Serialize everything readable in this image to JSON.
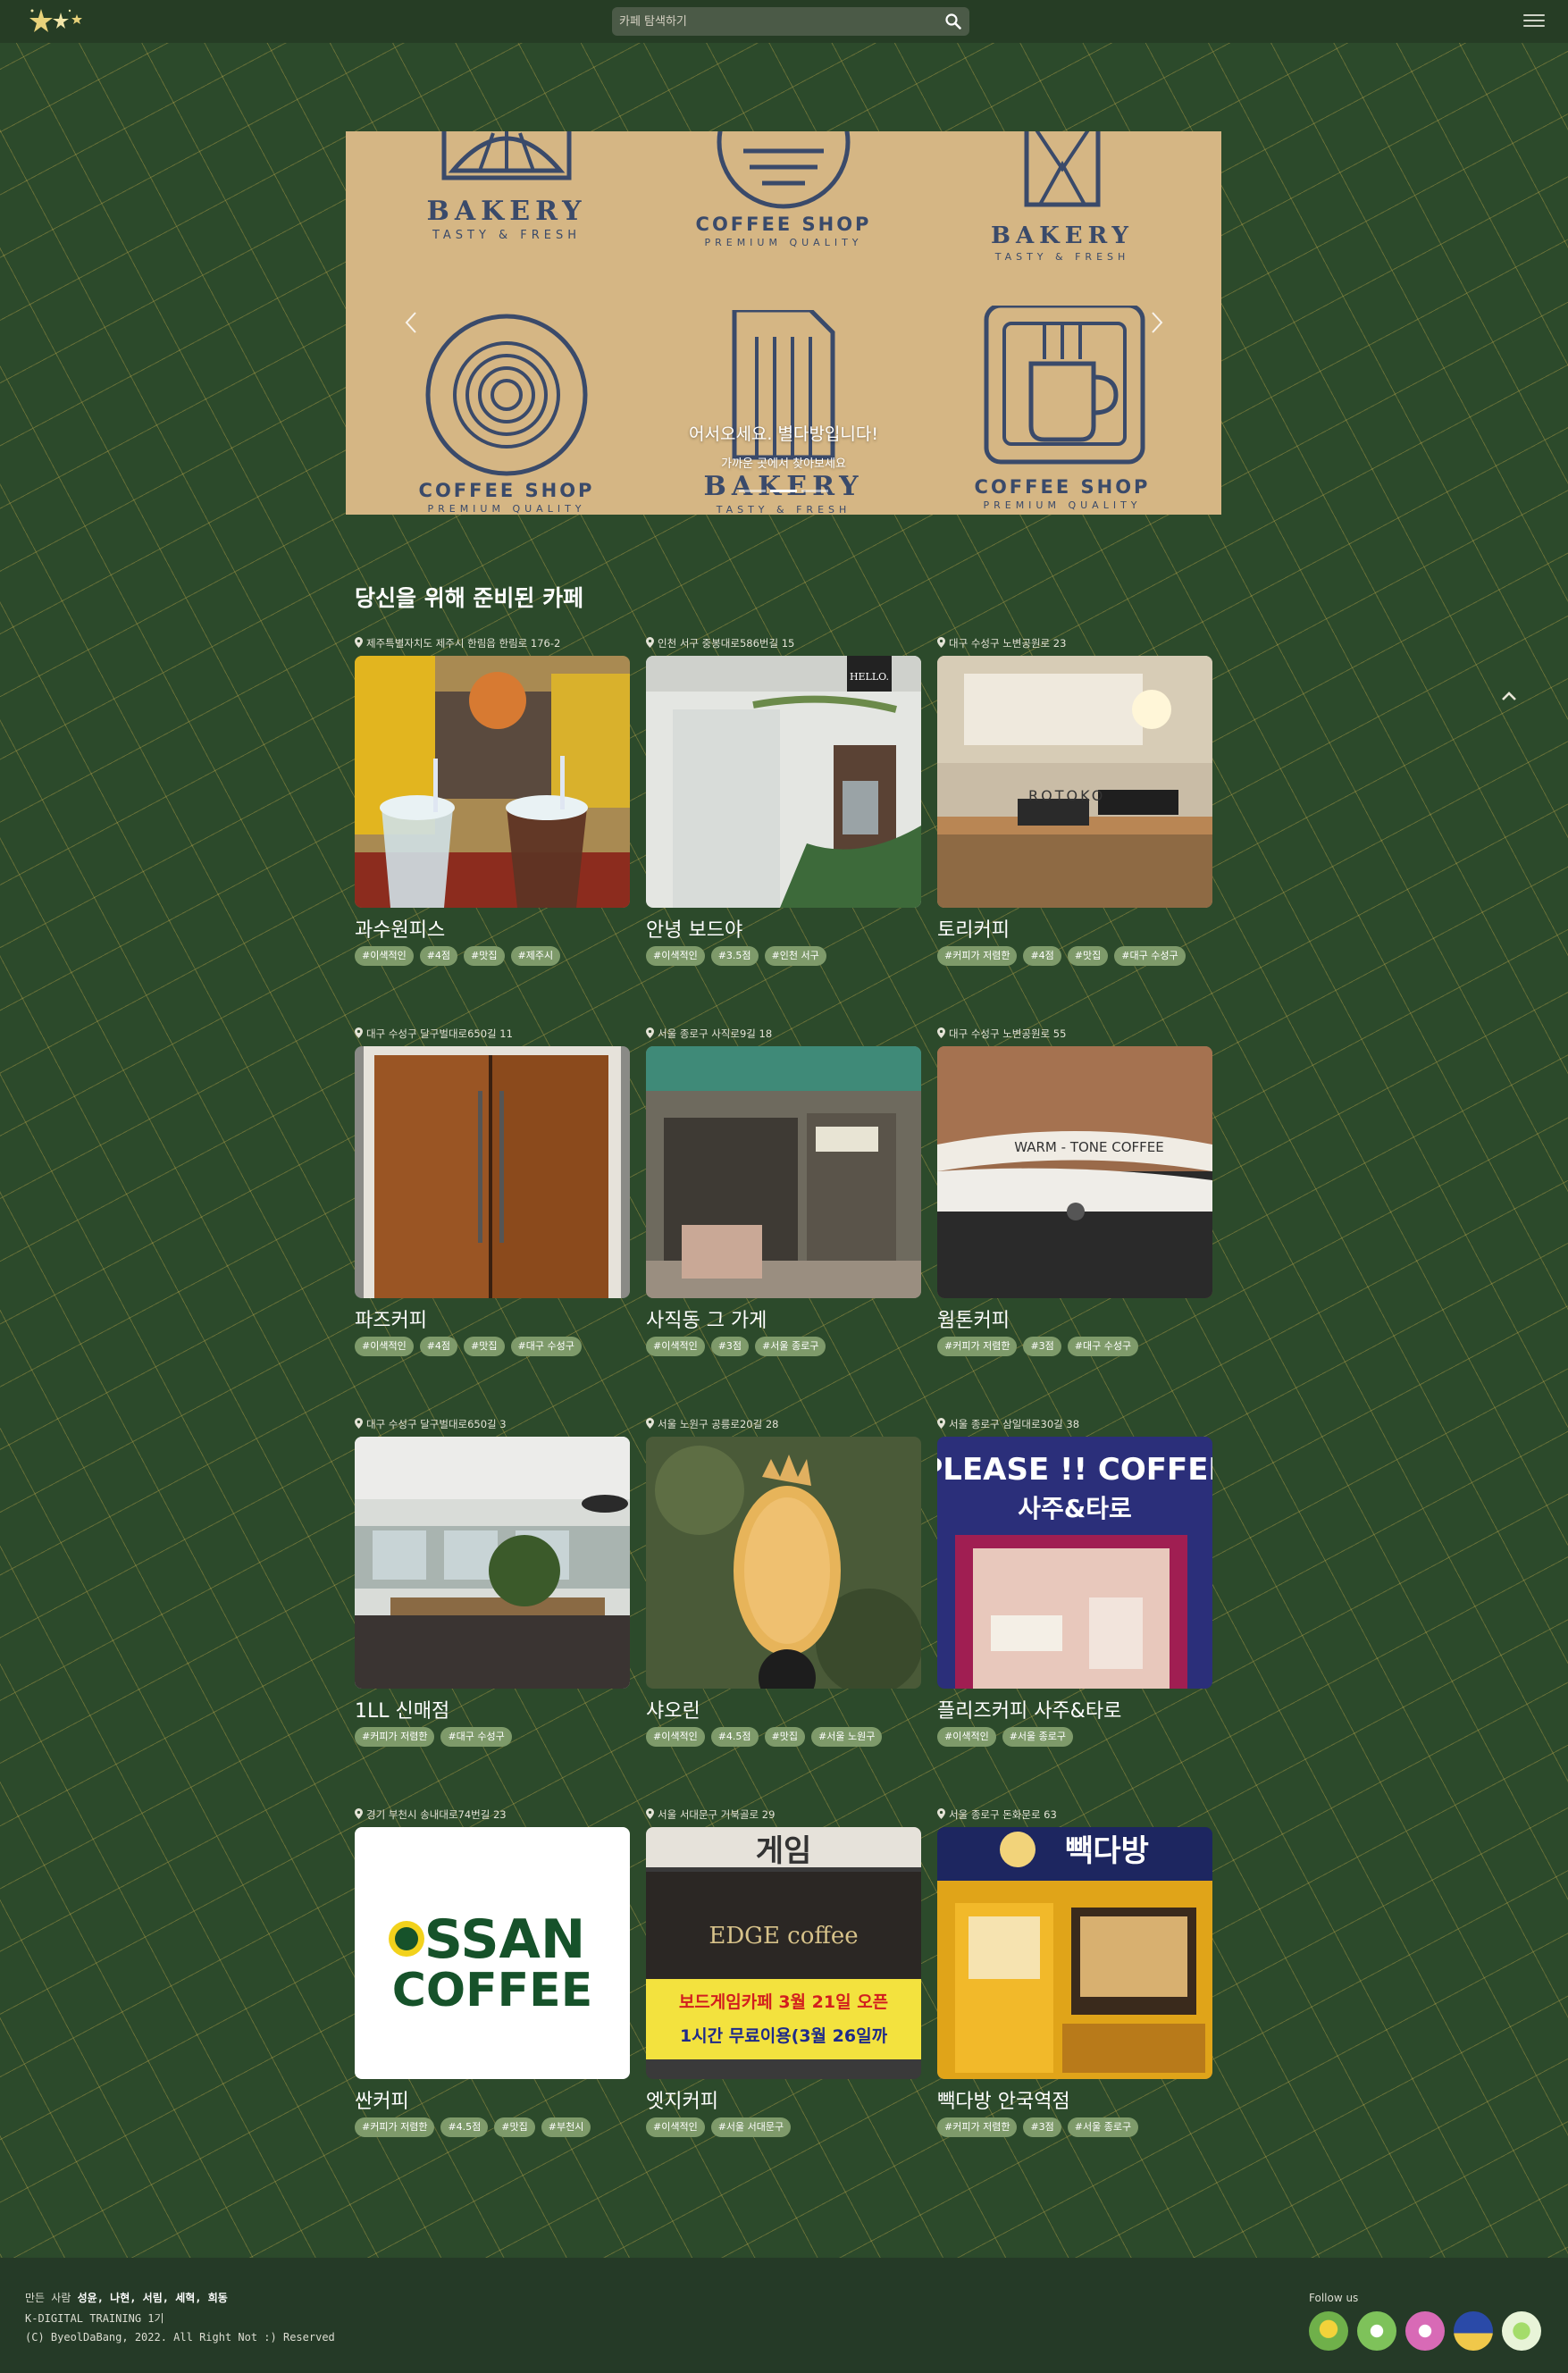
{
  "header": {
    "search_placeholder": "카페 탐색하기"
  },
  "carousel": {
    "title": "어서오세요. 별다방입니다!",
    "subtitle": "가까운 곳에서 찾아보세요",
    "slide_count": 3,
    "active_slide": 1,
    "logos": [
      {
        "big": "BAKERY",
        "small": "TASTY & FRESH"
      },
      {
        "big": "COFFEE SHOP",
        "small": "PREMIUM QUALITY"
      },
      {
        "big": "BAKERY",
        "small": "TASTY & FRESH"
      },
      {
        "big": "COFFEE SHOP",
        "small": "PREMIUM QUALITY"
      },
      {
        "big": "BAKERY",
        "small": "TASTY & FRESH"
      },
      {
        "big": "COFFEE SHOP",
        "small": "PREMIUM QUALITY"
      }
    ]
  },
  "section": {
    "title": "당신을 위해 준비된 카페"
  },
  "cafes": [
    {
      "address": "제주특별자치도 제주시 한림읍 한림로 176-2",
      "name": "과수원피스",
      "tags": [
        "#이색적인",
        "#4점",
        "#맛집",
        "#제주시"
      ]
    },
    {
      "address": "인천 서구 중봉대로586번길 15",
      "name": "안녕 보드야",
      "tags": [
        "#이색적인",
        "#3.5점",
        "#인천 서구"
      ]
    },
    {
      "address": "대구 수성구 노변공원로 23",
      "name": "토리커피",
      "tags": [
        "#커피가 저렴한",
        "#4점",
        "#맛집",
        "#대구 수성구"
      ]
    },
    {
      "address": "대구 수성구 달구벌대로650길 11",
      "name": "파즈커피",
      "tags": [
        "#이색적인",
        "#4점",
        "#맛집",
        "#대구 수성구"
      ]
    },
    {
      "address": "서울 종로구 사직로9길 18",
      "name": "사직동 그 가게",
      "tags": [
        "#이색적인",
        "#3점",
        "#서울 종로구"
      ]
    },
    {
      "address": "대구 수성구 노변공원로 55",
      "name": "웜톤커피",
      "tags": [
        "#커피가 저렴한",
        "#3점",
        "#대구 수성구"
      ]
    },
    {
      "address": "대구 수성구 달구벌대로650길 3",
      "name": "1LL 신매점",
      "tags": [
        "#커피가 저렴한",
        "#대구 수성구"
      ]
    },
    {
      "address": "서울 노원구 공릉로20길 28",
      "name": "샤오린",
      "tags": [
        "#이색적인",
        "#4.5점",
        "#맛집",
        "#서울 노원구"
      ]
    },
    {
      "address": "서울 종로구 삼일대로30길 38",
      "name": "플리즈커피 사주&타로",
      "tags": [
        "#이색적인",
        "#서울 종로구"
      ]
    },
    {
      "address": "경기 부천시 송내대로74번길 23",
      "name": "싼커피",
      "tags": [
        "#커피가 저렴한",
        "#4.5점",
        "#맛집",
        "#부천시"
      ]
    },
    {
      "address": "서울 서대문구 거북골로 29",
      "name": "엣지커피",
      "tags": [
        "#이색적인",
        "#서울 서대문구"
      ]
    },
    {
      "address": "서울 종로구 돈화문로 63",
      "name": "빽다방 안국역점",
      "tags": [
        "#커피가 저렴한",
        "#3점",
        "#서울 종로구"
      ]
    }
  ],
  "photo_text": {
    "hello_sign": "HELLO.",
    "rotoko_sign": "ROTOKO",
    "warm_tone_sign": "WARM - TONE COFFEE",
    "please_coffee_sign": "PLEASE !! COFFEE",
    "saju_sign": "사주&타로",
    "ssan_coffee_line1": "SSAN",
    "ssan_coffee_line2": "COFFEE",
    "edge_sign": "게임",
    "edge_coffee": "EDGE coffee",
    "edge_banner1": "보드게임카페 3월 21일 오픈",
    "edge_banner2": "1시간 무료이용(3월 26일까",
    "paik_sign": "빽다방"
  },
  "footer": {
    "credits_label": "만든 사람",
    "credits_names": "성윤, 나현, 서림, 세혁, 희동",
    "program": "K-DIGITAL TRAINING 1기",
    "copyright": "(C) ByeolDaBang, 2022. All Right Not :) Reserved",
    "follow": "Follow us"
  },
  "colors": {
    "background": "#2c4a2b",
    "header": "#263d25",
    "tag": "#7e9a6a",
    "carousel": "#d5b684",
    "logo_ink": "#3a4a6a"
  }
}
